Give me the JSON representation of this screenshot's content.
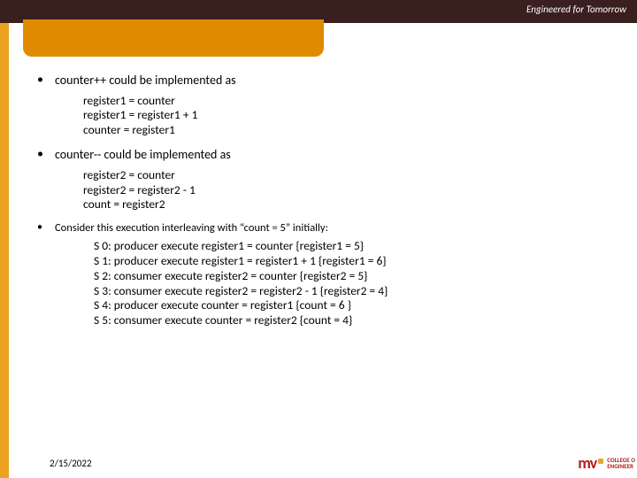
{
  "header": {
    "tagline": "Engineered for Tomorrow"
  },
  "bullets": {
    "b1": "counter++ could be implemented as",
    "code1_l1": "register1 = counter",
    "code1_l2": "register1 = register1 + 1",
    "code1_l3": "counter = register1",
    "b2": "counter-- could be implemented as",
    "code2_l1": "register2 = counter",
    "code2_l2": "register2 = register2 - 1",
    "code2_l3": "count = register2",
    "b3": "Consider this execution interleaving with “count = 5” initially:"
  },
  "interleave": {
    "s0": "S 0: producer execute register1 = counter   {register1 = 5}",
    "s1": "S 1: producer execute register1 = register1 + 1   {register1 = 6}",
    "s2": "S 2: consumer execute register2 = counter   {register2 = 5}",
    "s3": "S 3: consumer execute register2 = register2 - 1   {register2 = 4}",
    "s4": "S 4: producer execute counter = register1   {count = 6 }",
    "s5": "S 5: consumer execute counter = register2   {count = 4}"
  },
  "footer": {
    "date": "2/15/2022"
  },
  "logo": {
    "text": "mv",
    "sub1": "COLLEGE O",
    "sub2": "ENGINEER"
  }
}
